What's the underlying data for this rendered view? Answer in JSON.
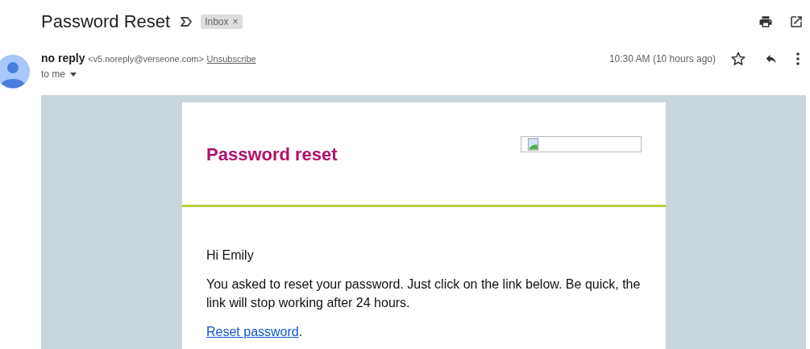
{
  "subject": "Password Reset",
  "label": {
    "text": "Inbox",
    "remove": "×"
  },
  "sender": {
    "name": "no reply",
    "address": "<v5.noreply@verseone.com>",
    "unsubscribe": "Unsubscribe",
    "recipient": "to me",
    "time": "10:30 AM (10 hours ago)",
    "starred": false
  },
  "body": {
    "heading": "Password reset",
    "greeting": "Hi Emily",
    "message": "You asked to reset your password. Just click on the link below. Be quick, the link will stop working after 24 hours.",
    "link": "Reset password",
    "link_suffix": "."
  }
}
